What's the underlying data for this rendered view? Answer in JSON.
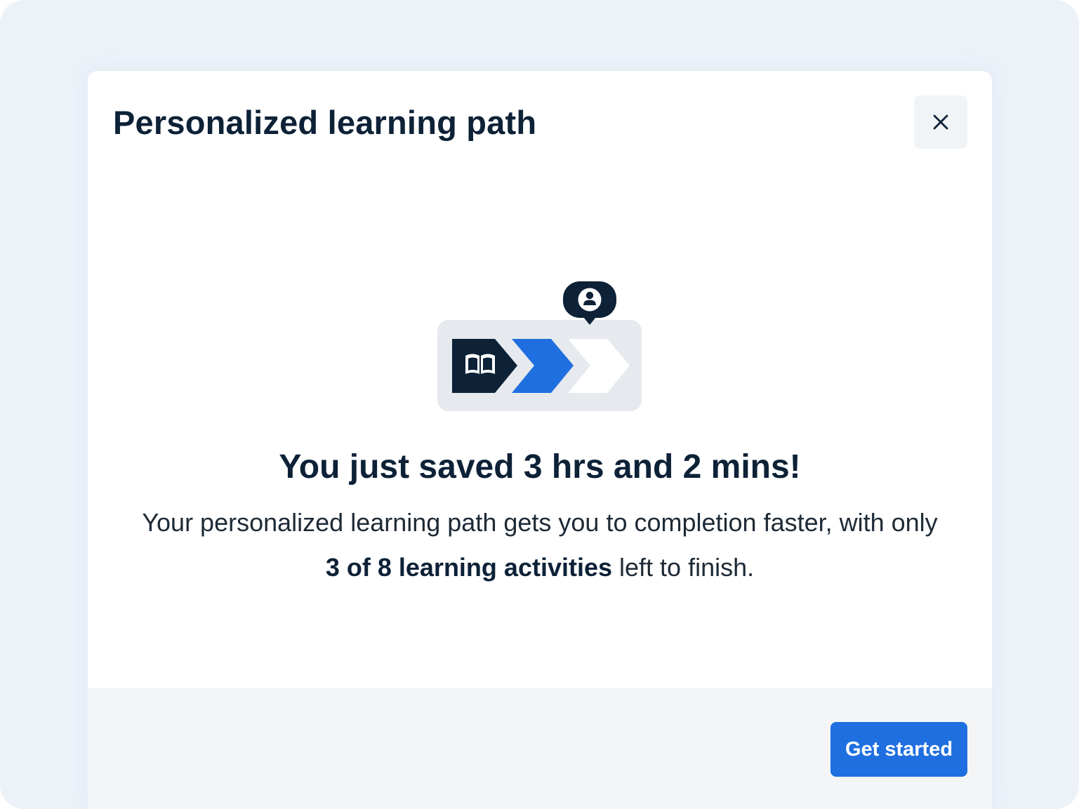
{
  "modal": {
    "title": "Personalized learning path",
    "close_icon": "close-icon"
  },
  "illustration": {
    "icons": [
      "book-icon",
      "user-marker-icon",
      "chevron-step-icon"
    ],
    "progress": {
      "completed_steps": 1,
      "current_step": 2,
      "total_steps": 3
    }
  },
  "content": {
    "headline": "You just saved 3 hrs and 2 mins!",
    "body_prefix": "Your personalized learning path gets you to completion faster, with only ",
    "body_emphasis": "3 of 8 learning activities",
    "body_suffix": " left to finish."
  },
  "footer": {
    "primary_button_label": "Get started"
  },
  "colors": {
    "backdrop": "#edf2f9",
    "title_text": "#0d2137",
    "accent_blue": "#1f6fe0",
    "dark_navy": "#0d2137",
    "footer_bg": "#f3f5f7",
    "close_bg": "#f1f4f6",
    "track_bg": "#e6e9ee"
  }
}
